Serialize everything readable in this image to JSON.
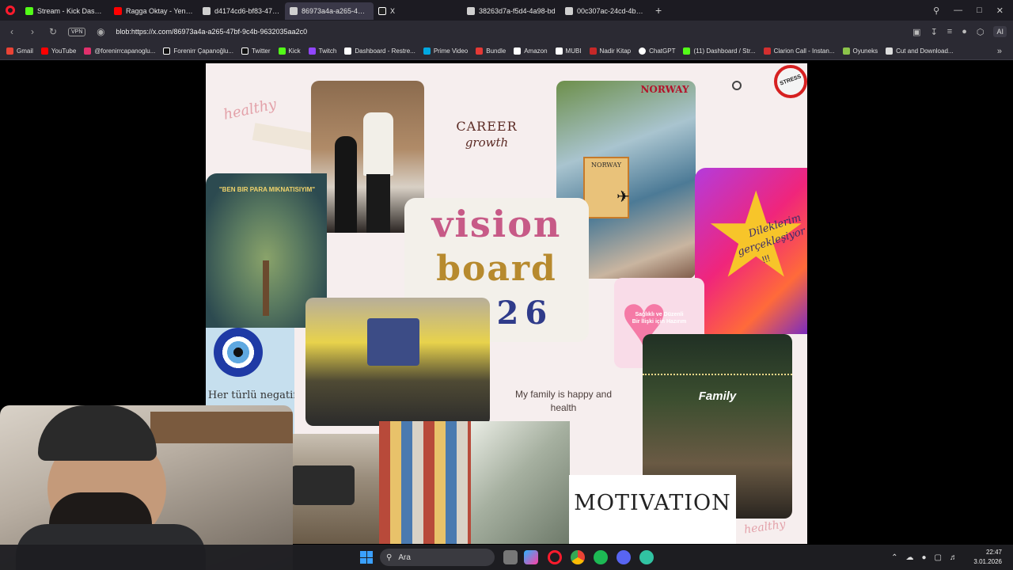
{
  "tabs": [
    {
      "label": "Stream - Kick Dashboard",
      "color": "#53fc18",
      "active": false
    },
    {
      "label": "Ragga Oktay - Yeniden (C",
      "color": "#ff0000",
      "active": false
    },
    {
      "label": "d4174cd6-bf83-47b8-9fa",
      "color": "#cfcfcf",
      "active": false
    },
    {
      "label": "86973a4a-a265-47bf-9c4",
      "color": "#cfcfcf",
      "active": true
    },
    {
      "label": "X",
      "color": "#ffffff",
      "active": false
    },
    {
      "label": "38263d7a-f5d4-4a98-bd",
      "color": "#cfcfcf",
      "active": false
    },
    {
      "label": "00c307ac-24cd-4b32-945",
      "color": "#cfcfcf",
      "active": false
    }
  ],
  "address": {
    "vpn": "VPN",
    "url": "blob:https://x.com/86973a4a-a265-47bf-9c4b-9632035aa2c0",
    "ai_label": "AI"
  },
  "bookmarks": [
    {
      "label": "Gmail",
      "color": "#ea4335"
    },
    {
      "label": "YouTube",
      "color": "#ff0000"
    },
    {
      "label": "@forenirrcapanoglu...",
      "color": "#e1306c"
    },
    {
      "label": "Forenirr Çapanoğlu...",
      "color": "#ffffff"
    },
    {
      "label": "Twitter",
      "color": "#ffffff"
    },
    {
      "label": "Kick",
      "color": "#53fc18"
    },
    {
      "label": "Twitch",
      "color": "#9146ff"
    },
    {
      "label": "Dashboard - Restre...",
      "color": "#ffffff"
    },
    {
      "label": "Prime Video",
      "color": "#00a8e1"
    },
    {
      "label": "Bundle",
      "color": "#e53935"
    },
    {
      "label": "Amazon",
      "color": "#ffffff"
    },
    {
      "label": "MUBI",
      "color": "#ffffff"
    },
    {
      "label": "Nadir Kitap",
      "color": "#c62828"
    },
    {
      "label": "ChatGPT",
      "color": "#ffffff"
    },
    {
      "label": "(11) Dashboard / Str...",
      "color": "#53fc18"
    },
    {
      "label": "Clarion Call - Instan...",
      "color": "#d32f2f"
    },
    {
      "label": "Oyuneks",
      "color": "#8bc34a"
    },
    {
      "label": "Cut and Download...",
      "color": "#ffffff"
    }
  ],
  "board": {
    "healthy_top": "healthy",
    "career": "CAREER",
    "growth": "growth",
    "norway_top": "NORWAY",
    "norway_poster": "NORWAY",
    "stress": "STRESS",
    "money_magnet": "\"BEN BIR PARA MIKNATISIYIM\"",
    "vision_line1": "vision",
    "vision_line2": "board",
    "vision_line3": "2026",
    "dilek_line1": "Dileklerim",
    "dilek_line2": "gerçekleşiyor",
    "dilek_line3": "!!!",
    "heart_text": "Sağlıklı ve Düzenli Bir İlişki için Hazırım",
    "negatif": "Her türlü negatif",
    "family_happy": "My family is happy and health",
    "family": "Family",
    "motivation": "MOTIVATION",
    "healthy_bottom": "healthy"
  },
  "taskbar": {
    "search_placeholder": "Ara",
    "time": "22:47",
    "date": "3.01.2026"
  }
}
